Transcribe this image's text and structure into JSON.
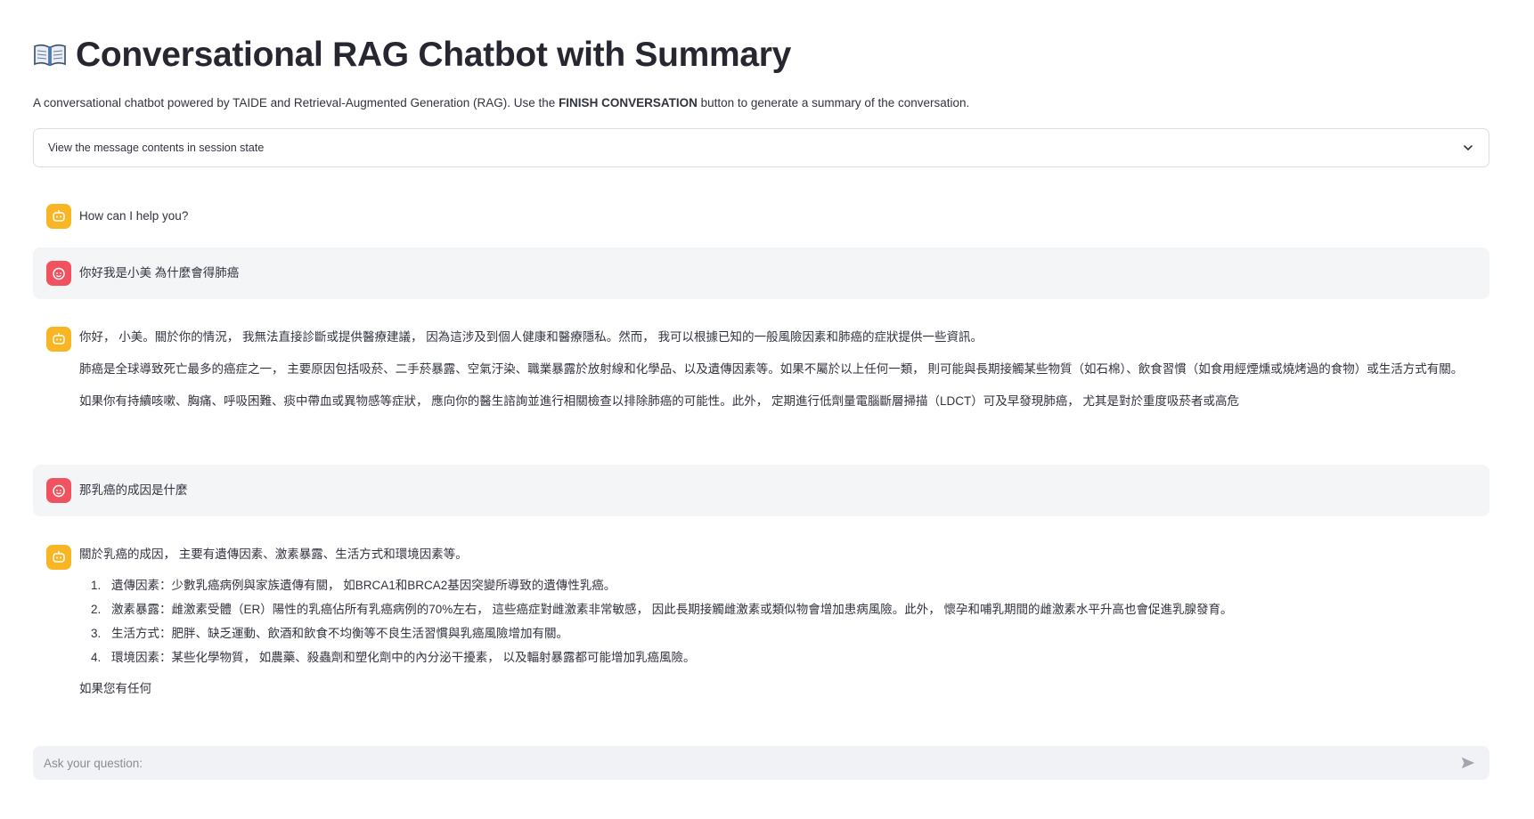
{
  "header": {
    "title": "Conversational RAG Chatbot with Summary",
    "title_icon": "open-book-icon",
    "subtitle_before": "A conversational chatbot powered by TAIDE and Retrieval-Augmented Generation (RAG). Use the ",
    "subtitle_bold": "FINISH CONVERSATION",
    "subtitle_after": " button to generate a summary of the conversation."
  },
  "expander": {
    "label": "View the message contents in session state",
    "icon": "chevron-down-icon"
  },
  "messages": [
    {
      "role": "assistant",
      "avatar_icon": "robot-icon",
      "paragraphs": [
        "How can I help you?"
      ]
    },
    {
      "role": "user",
      "avatar_icon": "user-face-icon",
      "paragraphs": [
        "你好我是小美 為什麼會得肺癌"
      ]
    },
    {
      "role": "assistant",
      "avatar_icon": "robot-icon",
      "paragraphs": [
        "你好， 小美。關於你的情況， 我無法直接診斷或提供醫療建議， 因為這涉及到個人健康和醫療隱私。然而， 我可以根據已知的一般風險因素和肺癌的症狀提供一些資訊。",
        "肺癌是全球導致死亡最多的癌症之一， 主要原因包括吸菸、二手菸暴露、空氣汙染、職業暴露於放射線和化學品、以及遺傳因素等。如果不屬於以上任何一類， 則可能與長期接觸某些物質（如石棉）、飲食習慣（如食用經煙燻或燒烤過的食物）或生活方式有關。",
        "如果你有持續咳嗽、胸痛、呼吸困難、痰中帶血或異物感等症狀， 應向你的醫生諮詢並進行相關檢查以排除肺癌的可能性。此外， 定期進行低劑量電腦斷層掃描（LDCT）可及早發現肺癌， 尤其是對於重度吸菸者或高危"
      ]
    },
    {
      "role": "user",
      "avatar_icon": "user-face-icon",
      "paragraphs": [
        "那乳癌的成因是什麼"
      ]
    },
    {
      "role": "assistant",
      "avatar_icon": "robot-icon",
      "intro": "關於乳癌的成因， 主要有遺傳因素、激素暴露、生活方式和環境因素等。",
      "list": [
        "遺傳因素：少數乳癌病例與家族遺傳有關， 如BRCA1和BRCA2基因突變所導致的遺傳性乳癌。",
        "激素暴露：雌激素受體（ER）陽性的乳癌佔所有乳癌病例的70%左右， 這些癌症對雌激素非常敏感， 因此長期接觸雌激素或類似物會增加患病風險。此外， 懷孕和哺乳期間的雌激素水平升高也會促進乳腺發育。",
        "生活方式：肥胖、缺乏運動、飲酒和飲食不均衡等不良生活習慣與乳癌風險增加有關。",
        "環境因素：某些化學物質， 如農藥、殺蟲劑和塑化劑中的內分泌干擾素， 以及輻射暴露都可能增加乳癌風險。"
      ],
      "outro": "如果您有任何"
    }
  ],
  "chat_input": {
    "placeholder": "Ask your question:",
    "value": "",
    "send_icon": "send-arrow-icon"
  },
  "colors": {
    "bot_avatar": "#f9b624",
    "user_avatar": "#f0535f",
    "user_bubble": "#f4f5f7",
    "input_bg": "#f0f2f6",
    "text": "#31333f"
  }
}
